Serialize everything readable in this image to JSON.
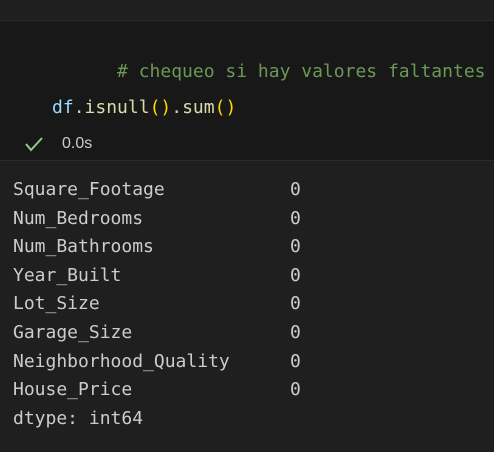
{
  "cell": {
    "code": {
      "comment": "# chequeo si hay valores faltantes",
      "line2": {
        "var": "df",
        "dot1": ".",
        "fn1": "isnull",
        "paren_open1": "(",
        "paren_close1": ")",
        "dot2": ".",
        "fn2": "sum",
        "paren_open2": "(",
        "paren_close2": ")"
      }
    },
    "status": {
      "icon": "check-icon",
      "time": "0.0s",
      "color": "#89d185"
    }
  },
  "output": {
    "rows": [
      {
        "name": "Square_Footage",
        "value": "0"
      },
      {
        "name": "Num_Bedrooms",
        "value": "0"
      },
      {
        "name": "Num_Bathrooms",
        "value": "0"
      },
      {
        "name": "Year_Built",
        "value": "0"
      },
      {
        "name": "Lot_Size",
        "value": "0"
      },
      {
        "name": "Garage_Size",
        "value": "0"
      },
      {
        "name": "Neighborhood_Quality",
        "value": "0"
      },
      {
        "name": "House_Price",
        "value": "0"
      }
    ],
    "dtype": "dtype: int64"
  }
}
